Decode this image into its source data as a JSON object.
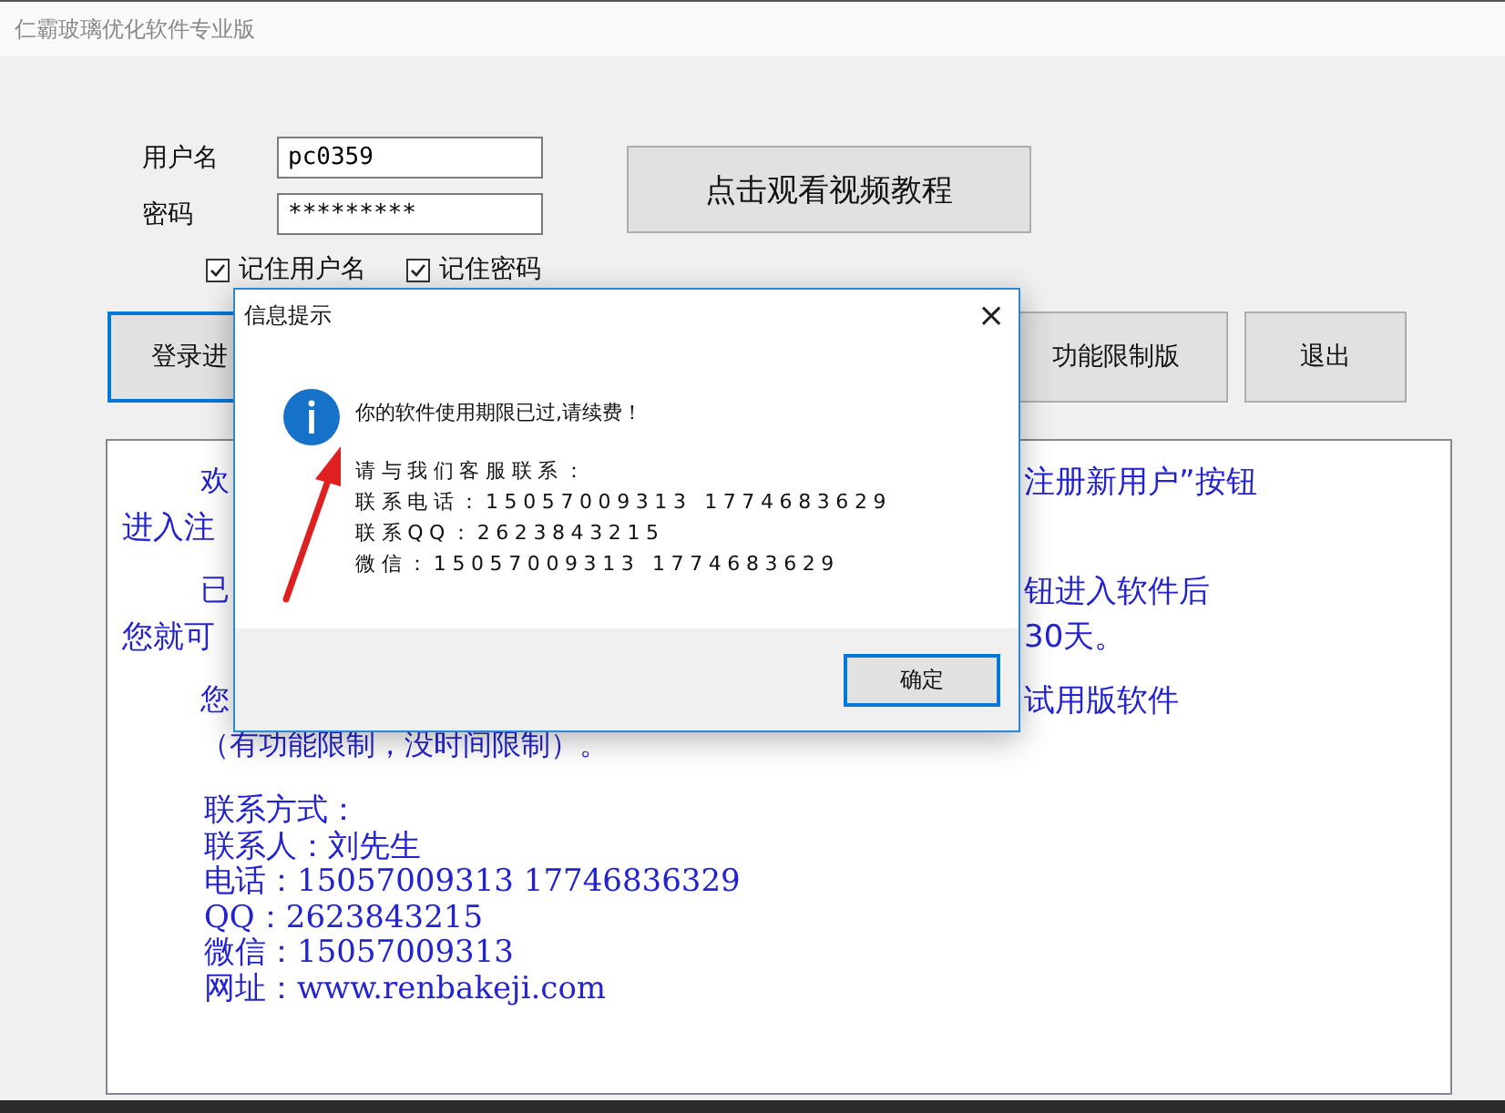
{
  "window": {
    "title": "仁霸玻璃优化软件专业版"
  },
  "login": {
    "username_label": "用户名",
    "username": "pc0359",
    "password_label": "密码",
    "password": "*********"
  },
  "checkboxes": [
    {
      "label": "记住用户名",
      "checked": true
    },
    {
      "label": "记住密码",
      "checked": true
    }
  ],
  "video_button": "点击观看视频教程",
  "buttons": [
    {
      "label": "登录进",
      "default": true
    },
    {
      "label": "功能限制版",
      "default": false
    },
    {
      "label": "退出",
      "default": false
    }
  ],
  "info_text": {
    "paragraphs": [
      {
        "lines": [
          {
            "kind": "indent",
            "left": "欢",
            "right": "注册新用户”按钮"
          },
          {
            "kind": "flush",
            "left": "进入注"
          }
        ]
      },
      {
        "lines": [
          {
            "kind": "indent",
            "left": "已",
            "right": "钮进入软件后"
          },
          {
            "kind": "flush",
            "left": "您就可",
            "right": "30天。"
          }
        ]
      },
      {
        "lines": [
          {
            "kind": "indent",
            "left": "您",
            "right": "试用版软件"
          },
          {
            "kind": "indent",
            "left": "（有功能限制，没时间限制）。"
          }
        ]
      }
    ],
    "contact": [
      "联系方式：",
      "联系人：刘先生",
      "电话：15057009313 17746836329",
      "QQ：2623843215",
      "微信：15057009313",
      "网址：www.renbakeji.com"
    ]
  },
  "dialog": {
    "title": "信息提示",
    "close": "×",
    "message": "你的软件使用期限已过,请续费！",
    "lines": [
      "请与我们客服联系：",
      "联系电话：15057009313  1774683629",
      "联系QQ：2623843215",
      "微信：15057009313  1774683629"
    ],
    "ok": "确定"
  }
}
